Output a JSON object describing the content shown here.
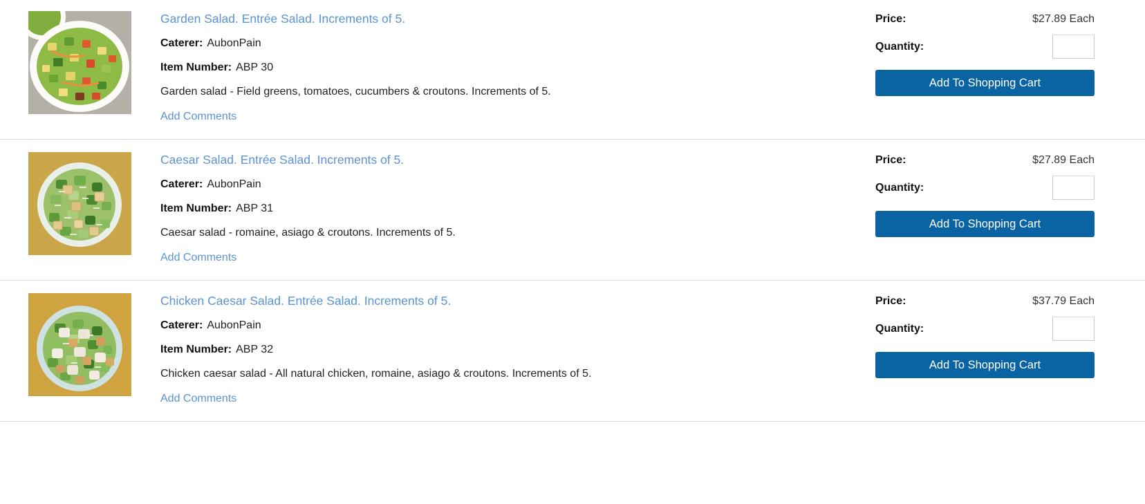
{
  "labels": {
    "caterer": "Caterer:",
    "item_number": "Item Number:",
    "price": "Price:",
    "quantity": "Quantity:",
    "add_comments": "Add Comments",
    "add_to_cart": "Add To Shopping Cart"
  },
  "colors": {
    "link": "#5b93d3",
    "button": "#0a64a4",
    "button_text": "#ffffff",
    "row_divider": "#dddddd",
    "input_border": "#c8c8c8",
    "text": "#222222"
  },
  "products": [
    {
      "title": "Garden Salad. Entrée Salad. Increments of 5.",
      "caterer": "AubonPain",
      "item_number": "ABP 30",
      "description": "Garden salad - Field greens, tomatoes, cucumbers & croutons. Increments of 5.",
      "price": "$27.89 Each",
      "quantity_value": "",
      "quantity_placeholder": "",
      "image_alt": "garden-salad-photo",
      "image_bg": "#b9b4ab",
      "bowl_color": "#f6f4ef"
    },
    {
      "title": "Caesar Salad. Entrée Salad. Increments of 5.",
      "caterer": "AubonPain",
      "item_number": "ABP 31",
      "description": "Caesar salad - romaine, asiago & croutons. Increments of 5.",
      "price": "$27.89 Each",
      "quantity_value": "",
      "quantity_placeholder": "",
      "image_alt": "caesar-salad-photo",
      "image_bg": "#ccа54a",
      "bowl_color": "#e7eeea"
    },
    {
      "title": "Chicken Caesar Salad. Entrée Salad. Increments of 5.",
      "caterer": "AubonPain",
      "item_number": "ABP 32",
      "description": "Chicken caesar salad - All natural chicken, romaine, asiago & croutons. Increments of 5.",
      "price": "$37.79 Each",
      "quantity_value": "",
      "quantity_placeholder": "",
      "image_alt": "chicken-caesar-salad-photo",
      "image_bg": "#cfa340",
      "bowl_color": "#cfe2e2"
    }
  ]
}
